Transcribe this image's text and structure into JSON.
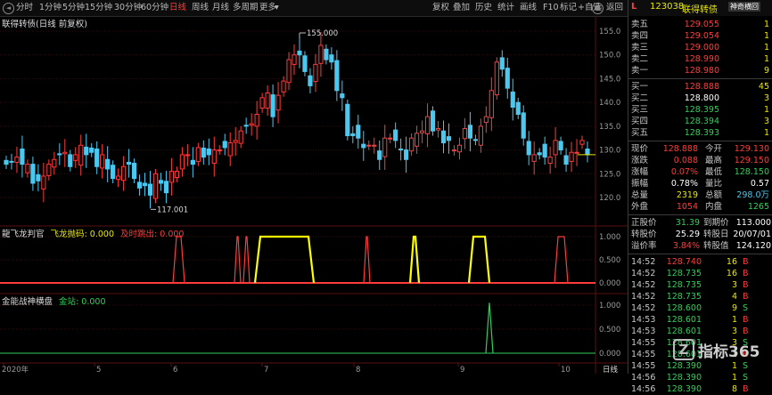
{
  "toolbar": {
    "periods": [
      {
        "label": "分时",
        "active": false
      },
      {
        "label": "1分钟",
        "active": false
      },
      {
        "label": "5分钟",
        "active": false
      },
      {
        "label": "15分钟",
        "active": false
      },
      {
        "label": "30分钟",
        "active": false
      },
      {
        "label": "60分钟",
        "active": false
      },
      {
        "label": "日线",
        "active": true
      },
      {
        "label": "周线",
        "active": false
      },
      {
        "label": "月线",
        "active": false
      },
      {
        "label": "多周期",
        "active": false
      },
      {
        "label": "更多",
        "active": false
      }
    ],
    "tools": [
      "复权",
      "叠加",
      "历史",
      "统计",
      "画线",
      "F10",
      "标记",
      "+自选",
      "返回"
    ]
  },
  "main_title": "联得转债(日线 前复权)",
  "kline_panel": {
    "y_labels": [
      "155.0",
      "150.0",
      "145.0",
      "140.0",
      "135.0",
      "130.0",
      "125.0",
      "120.0"
    ],
    "high_label": "155.000",
    "low_label": "117.001"
  },
  "indicator1": {
    "name": "龍飞龙判官",
    "series": [
      {
        "name": "飞龙抛码",
        "value": "0.000",
        "color": "#e8e800"
      },
      {
        "name": "及时跳出",
        "value": "0.000",
        "color": "#ff3b3b"
      }
    ],
    "y_labels": [
      "1.000",
      "0.500",
      "0.000"
    ]
  },
  "indicator2": {
    "name": "金能战神横盘",
    "series": [
      {
        "name": "金站",
        "value": "0.000",
        "color": "#2fd05a"
      }
    ],
    "y_labels": [
      "1.000",
      "0.500",
      "0.000"
    ]
  },
  "x_axis": {
    "labels": [
      "2020年",
      "5",
      "6",
      "7",
      "8",
      "9",
      "10"
    ],
    "period": "日线"
  },
  "quote": {
    "code": "123038",
    "name": "联得转债",
    "badge_left": "L",
    "asks": [
      {
        "label": "卖五",
        "price": "129.055",
        "vol": "1"
      },
      {
        "label": "卖四",
        "price": "129.054",
        "vol": "1"
      },
      {
        "label": "卖三",
        "price": "129.000",
        "vol": "1"
      },
      {
        "label": "卖二",
        "price": "128.990",
        "vol": "1"
      },
      {
        "label": "卖一",
        "price": "128.980",
        "vol": "9"
      }
    ],
    "bids": [
      {
        "label": "买一",
        "price": "128.888",
        "vol": "45"
      },
      {
        "label": "买二",
        "price": "128.800",
        "vol": "3"
      },
      {
        "label": "买三",
        "price": "128.395",
        "vol": "1"
      },
      {
        "label": "买四",
        "price": "128.394",
        "vol": "3"
      },
      {
        "label": "买五",
        "price": "128.393",
        "vol": "1"
      }
    ],
    "stats": [
      {
        "l1": "现价",
        "v1": "128.888",
        "c1": "red",
        "l2": "今开",
        "v2": "129.130",
        "c2": "red"
      },
      {
        "l1": "涨跌",
        "v1": "0.088",
        "c1": "red",
        "l2": "最高",
        "v2": "129.150",
        "c2": "red"
      },
      {
        "l1": "涨幅",
        "v1": "0.07%",
        "c1": "red",
        "l2": "最低",
        "v2": "128.150",
        "c2": "green"
      },
      {
        "l1": "振幅",
        "v1": "0.78%",
        "c1": "white",
        "l2": "量比",
        "v2": "0.57",
        "c2": "white"
      },
      {
        "l1": "总量",
        "v1": "2319",
        "c1": "yellow",
        "l2": "总额",
        "v2": "298.0万",
        "c2": "cyan"
      },
      {
        "l1": "外盘",
        "v1": "1054",
        "c1": "red",
        "l2": "内盘",
        "v2": "1265",
        "c2": "green"
      }
    ],
    "bond": [
      {
        "l1": "正股价",
        "v1": "31.39",
        "c1": "green",
        "l2": "到期价",
        "v2": "113.000",
        "c2": "white"
      },
      {
        "l1": "转股价",
        "v1": "25.29",
        "c1": "white",
        "l2": "转股日",
        "v2": "20/07/01",
        "c2": "white"
      },
      {
        "l1": "溢价率",
        "v1": "3.84%",
        "c1": "red",
        "l2": "转股值",
        "v2": "124.120",
        "c2": "white"
      }
    ],
    "ticks": [
      {
        "time": "14:52",
        "price": "128.740",
        "vol": "16",
        "side": "B"
      },
      {
        "time": "14:52",
        "price": "128.735",
        "vol": "16",
        "side": "B"
      },
      {
        "time": "14:52",
        "price": "128.735",
        "vol": "3",
        "side": "B"
      },
      {
        "time": "14:52",
        "price": "128.735",
        "vol": "4",
        "side": "B"
      },
      {
        "time": "14:52",
        "price": "128.600",
        "vol": "9",
        "side": "S"
      },
      {
        "time": "14:53",
        "price": "128.601",
        "vol": "1",
        "side": "B"
      },
      {
        "time": "14:53",
        "price": "128.601",
        "vol": "3",
        "side": "B"
      },
      {
        "time": "14:55",
        "price": "128.601",
        "vol": "3",
        "side": "S"
      },
      {
        "time": "14:55",
        "price": "128.601",
        "vol": "1",
        "side": "B"
      },
      {
        "time": "14:55",
        "price": "128.390",
        "vol": "1",
        "side": "S"
      },
      {
        "time": "14:56",
        "price": "128.390",
        "vol": "1",
        "side": "S"
      },
      {
        "time": "14:56",
        "price": "128.390",
        "vol": "8",
        "side": "B"
      }
    ]
  },
  "watermark": "指标365",
  "corner_text": "神奇横回",
  "colors": {
    "up": "#ff3b3b",
    "down": "#4ac8f0",
    "signal_yellow": "#ffff00",
    "signal_red": "#ff3b3b",
    "signal_green": "#2fd05a"
  }
}
